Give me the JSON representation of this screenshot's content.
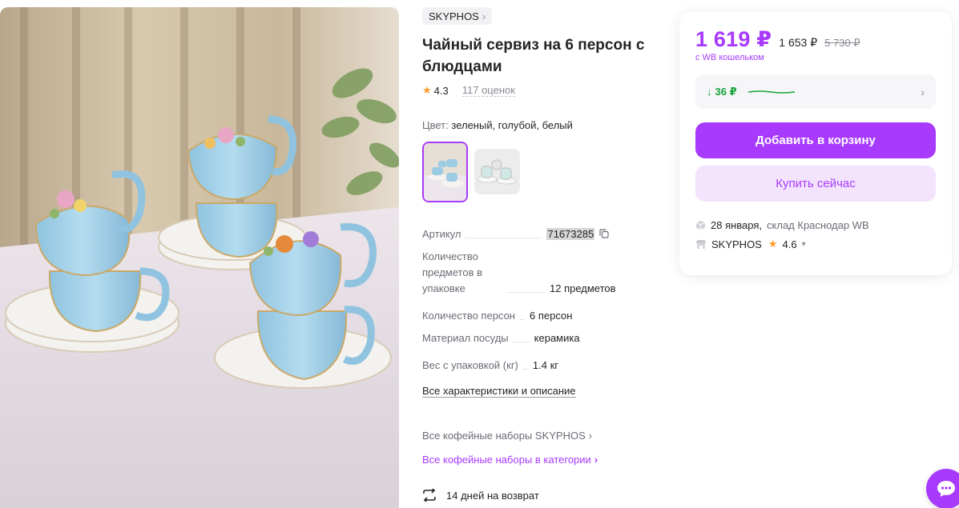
{
  "product": {
    "brand": "SKYPHOS",
    "title": "Чайный сервиз на 6 персон с блюдцами",
    "rating": "4.3",
    "reviews": "117 оценок",
    "color_label": "Цвет:",
    "color_value": "зеленый, голубой, белый"
  },
  "specs": [
    {
      "key": "Артикул",
      "value": "71673285"
    },
    {
      "key": "Количество предметов в упаковке",
      "value": "12 предметов"
    },
    {
      "key": "Количество персон",
      "value": "6 персон"
    },
    {
      "key": "Материал посуды",
      "value": "керамика"
    },
    {
      "key": "Вес с упаковкой (кг)",
      "value": "1.4 кг"
    }
  ],
  "links": {
    "all_chars": "Все характеристики и описание",
    "brand_sets": "Все кофейные наборы SKYPHOS",
    "category_sets": "Все кофейные наборы в категории",
    "returns": "14 дней на возврат"
  },
  "price": {
    "main": "1 619 ₽",
    "second": "1 653 ₽",
    "old": "5 730 ₽",
    "wallet": "с WB кошельком",
    "cashback": "36 ₽"
  },
  "buttons": {
    "cart": "Добавить в корзину",
    "buy": "Купить сейчас"
  },
  "delivery": {
    "date": "28 января,",
    "warehouse": "склад Краснодар WB"
  },
  "seller": {
    "name": "SKYPHOS",
    "rating": "4.6"
  },
  "colors": {
    "accent": "#a73afd",
    "accent_light": "#f3e3fd",
    "green": "#16a33c",
    "star": "#ff9c2b"
  }
}
